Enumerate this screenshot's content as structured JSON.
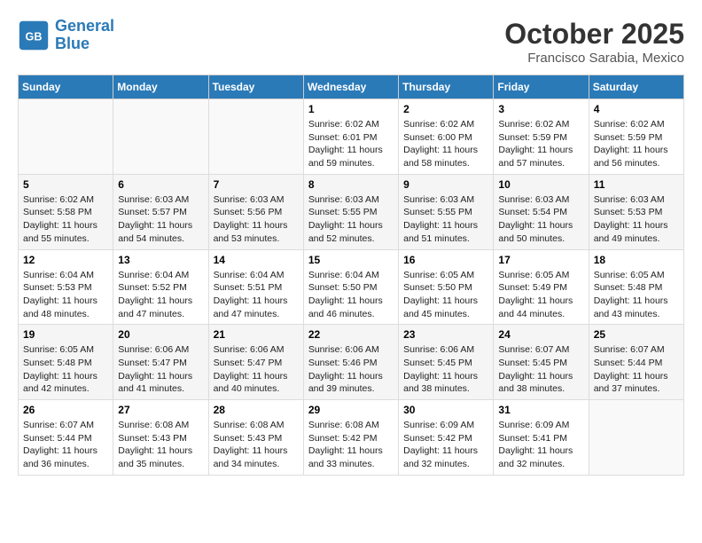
{
  "logo": {
    "line1": "General",
    "line2": "Blue"
  },
  "title": "October 2025",
  "subtitle": "Francisco Sarabia, Mexico",
  "weekdays": [
    "Sunday",
    "Monday",
    "Tuesday",
    "Wednesday",
    "Thursday",
    "Friday",
    "Saturday"
  ],
  "weeks": [
    [
      {
        "day": "",
        "empty": true
      },
      {
        "day": "",
        "empty": true
      },
      {
        "day": "",
        "empty": true
      },
      {
        "day": "1",
        "sunrise": "6:02 AM",
        "sunset": "6:01 PM",
        "daylight": "11 hours and 59 minutes."
      },
      {
        "day": "2",
        "sunrise": "6:02 AM",
        "sunset": "6:00 PM",
        "daylight": "11 hours and 58 minutes."
      },
      {
        "day": "3",
        "sunrise": "6:02 AM",
        "sunset": "5:59 PM",
        "daylight": "11 hours and 57 minutes."
      },
      {
        "day": "4",
        "sunrise": "6:02 AM",
        "sunset": "5:59 PM",
        "daylight": "11 hours and 56 minutes."
      }
    ],
    [
      {
        "day": "5",
        "sunrise": "6:02 AM",
        "sunset": "5:58 PM",
        "daylight": "11 hours and 55 minutes."
      },
      {
        "day": "6",
        "sunrise": "6:03 AM",
        "sunset": "5:57 PM",
        "daylight": "11 hours and 54 minutes."
      },
      {
        "day": "7",
        "sunrise": "6:03 AM",
        "sunset": "5:56 PM",
        "daylight": "11 hours and 53 minutes."
      },
      {
        "day": "8",
        "sunrise": "6:03 AM",
        "sunset": "5:55 PM",
        "daylight": "11 hours and 52 minutes."
      },
      {
        "day": "9",
        "sunrise": "6:03 AM",
        "sunset": "5:55 PM",
        "daylight": "11 hours and 51 minutes."
      },
      {
        "day": "10",
        "sunrise": "6:03 AM",
        "sunset": "5:54 PM",
        "daylight": "11 hours and 50 minutes."
      },
      {
        "day": "11",
        "sunrise": "6:03 AM",
        "sunset": "5:53 PM",
        "daylight": "11 hours and 49 minutes."
      }
    ],
    [
      {
        "day": "12",
        "sunrise": "6:04 AM",
        "sunset": "5:53 PM",
        "daylight": "11 hours and 48 minutes."
      },
      {
        "day": "13",
        "sunrise": "6:04 AM",
        "sunset": "5:52 PM",
        "daylight": "11 hours and 47 minutes."
      },
      {
        "day": "14",
        "sunrise": "6:04 AM",
        "sunset": "5:51 PM",
        "daylight": "11 hours and 47 minutes."
      },
      {
        "day": "15",
        "sunrise": "6:04 AM",
        "sunset": "5:50 PM",
        "daylight": "11 hours and 46 minutes."
      },
      {
        "day": "16",
        "sunrise": "6:05 AM",
        "sunset": "5:50 PM",
        "daylight": "11 hours and 45 minutes."
      },
      {
        "day": "17",
        "sunrise": "6:05 AM",
        "sunset": "5:49 PM",
        "daylight": "11 hours and 44 minutes."
      },
      {
        "day": "18",
        "sunrise": "6:05 AM",
        "sunset": "5:48 PM",
        "daylight": "11 hours and 43 minutes."
      }
    ],
    [
      {
        "day": "19",
        "sunrise": "6:05 AM",
        "sunset": "5:48 PM",
        "daylight": "11 hours and 42 minutes."
      },
      {
        "day": "20",
        "sunrise": "6:06 AM",
        "sunset": "5:47 PM",
        "daylight": "11 hours and 41 minutes."
      },
      {
        "day": "21",
        "sunrise": "6:06 AM",
        "sunset": "5:47 PM",
        "daylight": "11 hours and 40 minutes."
      },
      {
        "day": "22",
        "sunrise": "6:06 AM",
        "sunset": "5:46 PM",
        "daylight": "11 hours and 39 minutes."
      },
      {
        "day": "23",
        "sunrise": "6:06 AM",
        "sunset": "5:45 PM",
        "daylight": "11 hours and 38 minutes."
      },
      {
        "day": "24",
        "sunrise": "6:07 AM",
        "sunset": "5:45 PM",
        "daylight": "11 hours and 38 minutes."
      },
      {
        "day": "25",
        "sunrise": "6:07 AM",
        "sunset": "5:44 PM",
        "daylight": "11 hours and 37 minutes."
      }
    ],
    [
      {
        "day": "26",
        "sunrise": "6:07 AM",
        "sunset": "5:44 PM",
        "daylight": "11 hours and 36 minutes."
      },
      {
        "day": "27",
        "sunrise": "6:08 AM",
        "sunset": "5:43 PM",
        "daylight": "11 hours and 35 minutes."
      },
      {
        "day": "28",
        "sunrise": "6:08 AM",
        "sunset": "5:43 PM",
        "daylight": "11 hours and 34 minutes."
      },
      {
        "day": "29",
        "sunrise": "6:08 AM",
        "sunset": "5:42 PM",
        "daylight": "11 hours and 33 minutes."
      },
      {
        "day": "30",
        "sunrise": "6:09 AM",
        "sunset": "5:42 PM",
        "daylight": "11 hours and 32 minutes."
      },
      {
        "day": "31",
        "sunrise": "6:09 AM",
        "sunset": "5:41 PM",
        "daylight": "11 hours and 32 minutes."
      },
      {
        "day": "",
        "empty": true
      }
    ]
  ]
}
